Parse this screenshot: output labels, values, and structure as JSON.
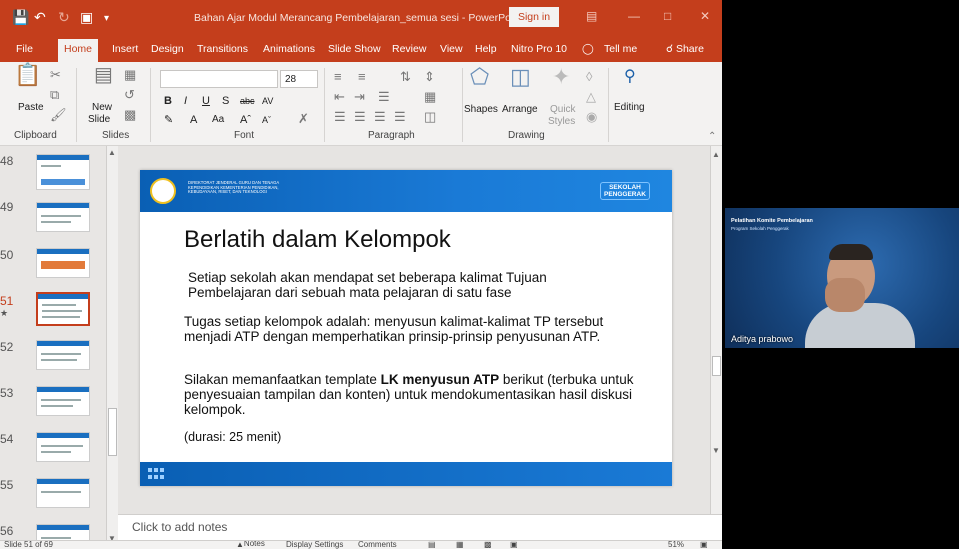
{
  "window": {
    "doc_title": "Bahan Ajar Modul Merancang Pembelajaran_semua sesi  -  PowerPoint",
    "sign_in": "Sign in",
    "colors": {
      "accent": "#c43e1c",
      "slide_blue": "#1a6fc0",
      "highlight": "#f3c300"
    }
  },
  "tabs": [
    "File",
    "Home",
    "Insert",
    "Design",
    "Transitions",
    "Animations",
    "Slide Show",
    "Review",
    "View",
    "Help",
    "Nitro Pro 10"
  ],
  "tell_me": "Tell me",
  "share": "Share",
  "ribbon": {
    "paste": "Paste",
    "new_slide": "New",
    "new_slide2": "Slide",
    "font_size": "28",
    "shapes": "Shapes",
    "arrange": "Arrange",
    "quick": "Quick",
    "styles": "Styles",
    "editing": "Editing",
    "groups": [
      "Clipboard",
      "Slides",
      "Font",
      "Paragraph",
      "Drawing"
    ]
  },
  "thumbnails": {
    "numbers": [
      "48",
      "49",
      "50",
      "51",
      "52",
      "53",
      "54",
      "55",
      "56"
    ],
    "star": "★"
  },
  "slide": {
    "org": "DIREKTORAT JENDERAL GURU DAN TENAGA KEPENDIDIKAN KEMENTERIAN PENDIDIKAN, KEBUDAYAAN, RISET, DAN TEKNOLOGI",
    "brand_line1": "SEKOLAH",
    "brand_line2": "PENGGERAK",
    "title": "Berlatih dalam Kelompok",
    "p1": "Setiap sekolah akan mendapat set beberapa kalimat Tujuan Pembelajaran dari sebuah mata pelajaran di satu fase",
    "p2": "Tugas setiap kelompok adalah: menyusun kalimat-kalimat TP tersebut menjadi ATP dengan  memperhatikan prinsip-prinsip penyusunan ATP.",
    "p3_pre": "Silakan memanfaatkan template ",
    "p3_bold": "LK menyusun ATP",
    "p3_post": " berikut (terbuka untuk penyesuaian tampilan dan konten) untuk mendokumentasikan hasil diskusi kelompok.",
    "p4": "(durasi: 25 menit)"
  },
  "notes_placeholder": "Click to add notes",
  "status": {
    "slide_count": "Slide 51 of 69",
    "notes": "Notes",
    "display": "Display Settings",
    "comments": "Comments",
    "zoom": "51%"
  },
  "video": {
    "title": "Pelatihan Komite Pembelajaran",
    "subtitle": "Program Sekolah Penggerak",
    "participant": "Aditya prabowo"
  }
}
